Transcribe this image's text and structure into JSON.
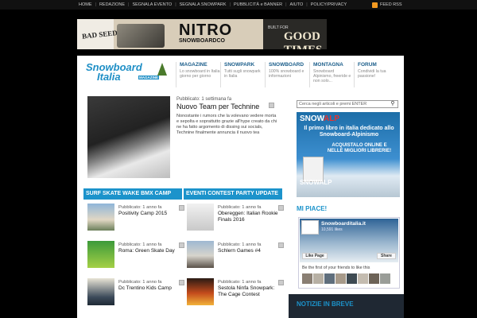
{
  "topnav": {
    "items": [
      "HOME",
      "REDAZIONE",
      "SEGNALA EVENTO",
      "SEGNALA SNOWPARK",
      "PUBBLICITÀ e BANNER",
      "AIUTO",
      "POLICY/PRIVACY"
    ],
    "feed": "FEED RSS"
  },
  "banner": {
    "left_text": "BAD SEEDS!",
    "brand": "NITRO",
    "brand_sub": "SNOWBOARDCO",
    "built": "BUILT FOR",
    "slogan": "GOOD TIMES"
  },
  "logo": {
    "line1": "Snowboard",
    "line2": "Italia",
    "tag": "MAGAZINE"
  },
  "menu": [
    {
      "title": "MAGAZINE",
      "desc": "Lo snowboard in Italia giorno per giorno"
    },
    {
      "title": "SNOWPARK",
      "desc": "Tutti sugli snowpark in Italia"
    },
    {
      "title": "SNOWBOARD",
      "desc": "100% snowboard e informazioni"
    },
    {
      "title": "MONTAGNA",
      "desc": "Snowboard Alpinismo, freeride e non solo..."
    },
    {
      "title": "FORUM",
      "desc": "Condividi la tua passione!"
    }
  ],
  "featured": {
    "meta": "Pubblicato: 1 settimana fa",
    "title": "Nuovo Team per Technine",
    "text": "Nonostante i rumors che la volevano vedere morta e sepolta e soprattutto grazie all'hype creato da chi ne ha fatto argomento di dissing sui socials, Technine finalmente annuncia il nuovo tea"
  },
  "sections": {
    "left": {
      "heading": "SURF SKATE WAKE BMX CAMP",
      "posts": [
        {
          "meta": "Pubblicato: 1 anno fa",
          "title": "Positivity Camp 2015"
        },
        {
          "meta": "Pubblicato: 1 anno fa",
          "title": "Roma: Green Skate Day"
        },
        {
          "meta": "Pubblicato: 1 anno fa",
          "title": "Dc Trentino Kids Camp"
        }
      ]
    },
    "right": {
      "heading": "EVENTI CONTEST PARTY UPDATE",
      "posts": [
        {
          "meta": "Pubblicato: 1 anno fa",
          "title": "Obereggen: Italian Rookie Finals 2016"
        },
        {
          "meta": "Pubblicato: 1 anno fa",
          "title": "Schlern Games #4"
        },
        {
          "meta": "Pubblicato: 1 anno fa",
          "title": "Sestola Ninfa Snowpark: The Cage Contest"
        }
      ]
    }
  },
  "sidebar": {
    "search_placeholder": "Cerca negli articoli e premi ENTER",
    "ad": {
      "brand": "SNOW",
      "brand2": "ALP",
      "line1": "Il primo libro in italia dedicato allo Snowboard-Alpinismo",
      "line2": "ACQUISTALO ONLINE E NELLE MIGLIORI LIBRERIE!",
      "brand3": "SNOWALP"
    },
    "mipiace": "MI PIACE!",
    "facebook": {
      "name": "Snowboarditalia.it",
      "likes": "10,591 likes",
      "like_label": "Like Page",
      "share_label": "Share",
      "friends": "Be the first of your friends to like this"
    },
    "notizie": "NOTIZIE IN BREVE"
  }
}
